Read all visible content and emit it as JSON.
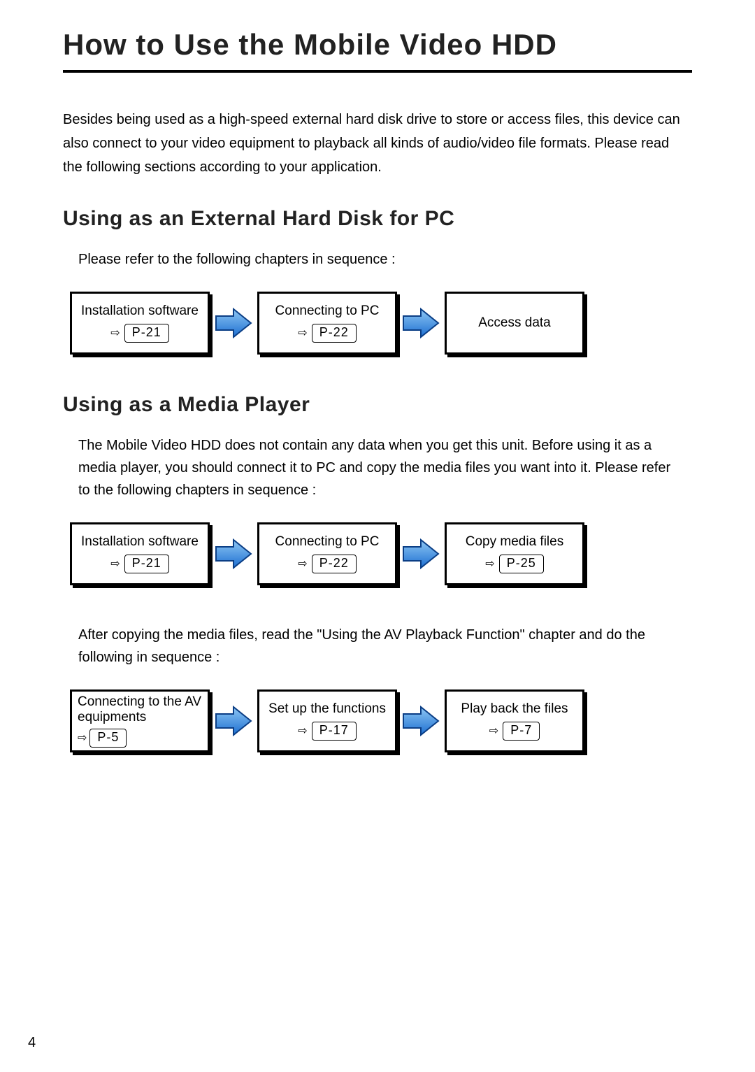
{
  "page_number": "4",
  "title": "How to Use the Mobile Video HDD",
  "intro": "Besides being used as a high-speed external hard disk drive to store or access files, this device can also connect to your video equipment to playback all kinds of audio/video file formats. Please read the following sections according to your application.",
  "section_pc": {
    "heading": "Using as an External Hard Disk for PC",
    "text": "Please refer to the following chapters in sequence :",
    "steps": [
      {
        "label": "Installation software",
        "page": "P-21"
      },
      {
        "label": "Connecting to PC",
        "page": "P-22"
      },
      {
        "label": "Access data",
        "page": ""
      }
    ]
  },
  "section_media": {
    "heading": "Using as a Media Player",
    "text1": "The Mobile Video HDD does not contain any data when you get this unit. Before using it as a media player, you should connect it to PC and copy the media files you want into it. Please refer to the following chapters in sequence :",
    "steps1": [
      {
        "label": "Installation software",
        "page": "P-21"
      },
      {
        "label": "Connecting to PC",
        "page": "P-22"
      },
      {
        "label": "Copy media files",
        "page": "P-25"
      }
    ],
    "text2": "After copying the media files, read the \"Using the AV Playback Function\" chapter and do the following in sequence :",
    "steps2": [
      {
        "label_pre": "Connecting to the AV equipments",
        "page": "P-5"
      },
      {
        "label": "Set up the functions",
        "page": "P-17"
      },
      {
        "label": "Play back the files",
        "page": "P-7"
      }
    ]
  },
  "glyphs": {
    "hollow_right_arrow": "⇨"
  }
}
